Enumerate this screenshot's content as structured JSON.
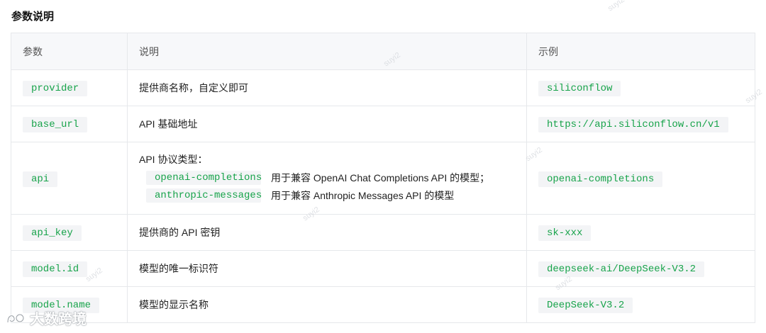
{
  "section_title": "参数说明",
  "table": {
    "headers": [
      "参数",
      "说明",
      "示例"
    ],
    "rows": [
      {
        "param": "provider",
        "desc": "提供商名称，自定义即可",
        "example": "siliconflow"
      },
      {
        "param": "base_url",
        "desc": "API 基础地址",
        "example": "https://api.siliconflow.cn/v1"
      },
      {
        "param": "api",
        "desc": "API 协议类型：",
        "desc_items": [
          {
            "code": "openai-completions",
            "text": "用于兼容 OpenAI Chat Completions API 的模型；"
          },
          {
            "code": "anthropic-messages",
            "text": "用于兼容 Anthropic Messages API 的模型"
          }
        ],
        "example": "openai-completions"
      },
      {
        "param": "api_key",
        "desc": "提供商的 API 密钥",
        "example": "sk-xxx"
      },
      {
        "param": "model.id",
        "desc": "模型的唯一标识符",
        "example": "deepseek-ai/DeepSeek-V3.2"
      },
      {
        "param": "model.name",
        "desc": "模型的显示名称",
        "example": "DeepSeek-V3.2"
      }
    ]
  },
  "watermark_text": "suyi2",
  "logo_text": "大数跨境"
}
